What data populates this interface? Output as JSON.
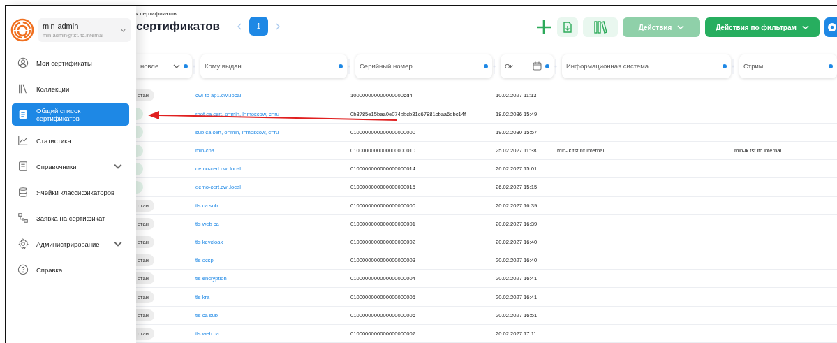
{
  "user": {
    "name": "min-admin",
    "email": "min-admin@tst.itc.internal"
  },
  "nav": [
    {
      "label": "Мои сертификаты",
      "selected": false
    },
    {
      "label": "Коллекции",
      "selected": false
    },
    {
      "label": "Общий список сертификатов",
      "selected": true
    },
    {
      "label": "Статистика",
      "selected": false
    },
    {
      "label": "Справочники",
      "selected": false,
      "expanded": false
    },
    {
      "label": "Ячейки классификаторов",
      "selected": false
    },
    {
      "label": "Заявка на сертификат",
      "selected": false
    },
    {
      "label": "Администрирование",
      "selected": false,
      "expanded": false
    },
    {
      "label": "Справка",
      "selected": false
    }
  ],
  "breadcrumb": "к сертификатов",
  "title": "сертификатов",
  "pagination": {
    "pages": [
      {
        "label": "1",
        "selected": true
      }
    ]
  },
  "toolbar": {
    "actions": {
      "label": "Действия",
      "disabled": true
    },
    "filter_actions": {
      "label": "Действия по фильтрам",
      "disabled": false
    }
  },
  "table": {
    "columns": [
      {
        "label": "новле...",
        "kind": "select"
      },
      {
        "label": "Кому выдан",
        "kind": "text"
      },
      {
        "label": "Серийный номер",
        "kind": "text"
      },
      {
        "label": "Ок...",
        "kind": "date"
      },
      {
        "label": "Информационная система",
        "kind": "text"
      },
      {
        "label": "Стрим",
        "kind": "text"
      }
    ],
    "rows": [
      {
        "status": {
          "kind": "neutral",
          "text": "отан"
        },
        "issued_to": "cwi-tc-ap1.cwi.local",
        "serial": "1000000000000000006d4",
        "date": "10.02.2027 11:13"
      },
      {
        "status": {
          "kind": "success"
        },
        "issued_to": "root ca cert, o=min, l=moscow, c=ru",
        "serial": "0b8785e15baa0e074bbcb31c67881cbaa6dbc14f",
        "date": "18.02.2036 15:49"
      },
      {
        "status": {
          "kind": "success"
        },
        "issued_to": "sub ca cert, o=min, l=moscow, c=ru",
        "serial": "0100000000000000000000",
        "date": "19.02.2030 15:57"
      },
      {
        "status": {
          "kind": "success"
        },
        "issued_to": "min-cpa",
        "serial": "0100000000000000000010",
        "date": "25.02.2027 11:38",
        "info_system": "min-lk.tst.itc.internal",
        "stream": "min-lk.tst.itc.internal"
      },
      {
        "status": {
          "kind": "success"
        },
        "issued_to": "demo-cert.cwi.local",
        "serial": "0100000000000000000014",
        "date": "26.02.2027 15:01"
      },
      {
        "status": {
          "kind": "success"
        },
        "issued_to": "demo-cert.cwi.local",
        "serial": "0100000000000000000015",
        "date": "26.02.2027 15:15"
      },
      {
        "status": {
          "kind": "neutral",
          "text": "отан"
        },
        "issued_to": "tls ca sub",
        "serial": "0100000000000000000000",
        "date": "20.02.2027 16:39"
      },
      {
        "status": {
          "kind": "neutral",
          "text": "отан"
        },
        "issued_to": "tls web ca",
        "serial": "0100000000000000000001",
        "date": "20.02.2027 16:39"
      },
      {
        "status": {
          "kind": "neutral",
          "text": "отан"
        },
        "issued_to": "tls keycloak",
        "serial": "0100000000000000000002",
        "date": "20.02.2027 16:40"
      },
      {
        "status": {
          "kind": "neutral",
          "text": "отан"
        },
        "issued_to": "tls ocsp",
        "serial": "0100000000000000000003",
        "date": "20.02.2027 16:40"
      },
      {
        "status": {
          "kind": "neutral",
          "text": "отан"
        },
        "issued_to": "tls encryption",
        "serial": "0100000000000000000004",
        "date": "20.02.2027 16:41"
      },
      {
        "status": {
          "kind": "neutral",
          "text": "отан"
        },
        "issued_to": "tls kra",
        "serial": "0100000000000000000005",
        "date": "20.02.2027 16:41"
      },
      {
        "status": {
          "kind": "neutral",
          "text": "отан"
        },
        "issued_to": "tls ca sub",
        "serial": "0100000000000000000006",
        "date": "20.02.2027 16:51"
      },
      {
        "status": {
          "kind": "neutral",
          "text": "отан"
        },
        "issued_to": "tls web ca",
        "serial": "0100000000000000000007",
        "date": "20.02.2027 17:11"
      }
    ]
  }
}
